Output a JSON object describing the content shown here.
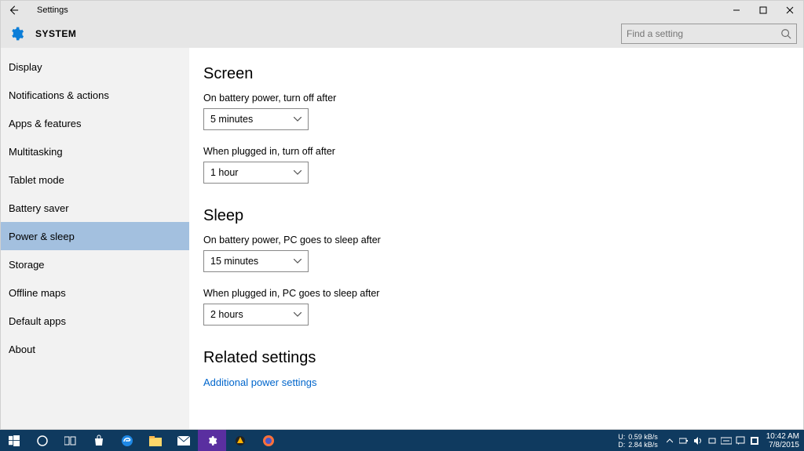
{
  "titlebar": {
    "title": "Settings"
  },
  "header": {
    "category": "SYSTEM",
    "search_placeholder": "Find a setting"
  },
  "sidebar": {
    "items": [
      {
        "label": "Display"
      },
      {
        "label": "Notifications & actions"
      },
      {
        "label": "Apps & features"
      },
      {
        "label": "Multitasking"
      },
      {
        "label": "Tablet mode"
      },
      {
        "label": "Battery saver"
      },
      {
        "label": "Power & sleep",
        "selected": true
      },
      {
        "label": "Storage"
      },
      {
        "label": "Offline maps"
      },
      {
        "label": "Default apps"
      },
      {
        "label": "About"
      }
    ]
  },
  "content": {
    "screen_heading": "Screen",
    "screen_battery_label": "On battery power, turn off after",
    "screen_battery_value": "5 minutes",
    "screen_plugged_label": "When plugged in, turn off after",
    "screen_plugged_value": "1 hour",
    "sleep_heading": "Sleep",
    "sleep_battery_label": "On battery power, PC goes to sleep after",
    "sleep_battery_value": "15 minutes",
    "sleep_plugged_label": "When plugged in, PC goes to sleep after",
    "sleep_plugged_value": "2 hours",
    "related_heading": "Related settings",
    "related_link": "Additional power settings"
  },
  "taskbar": {
    "net_u_label": "U:",
    "net_d_label": "D:",
    "net_u_speed": "0.59 kB/s",
    "net_d_speed": "2.84 kB/s",
    "time": "10:42 AM",
    "date": "7/8/2015"
  }
}
